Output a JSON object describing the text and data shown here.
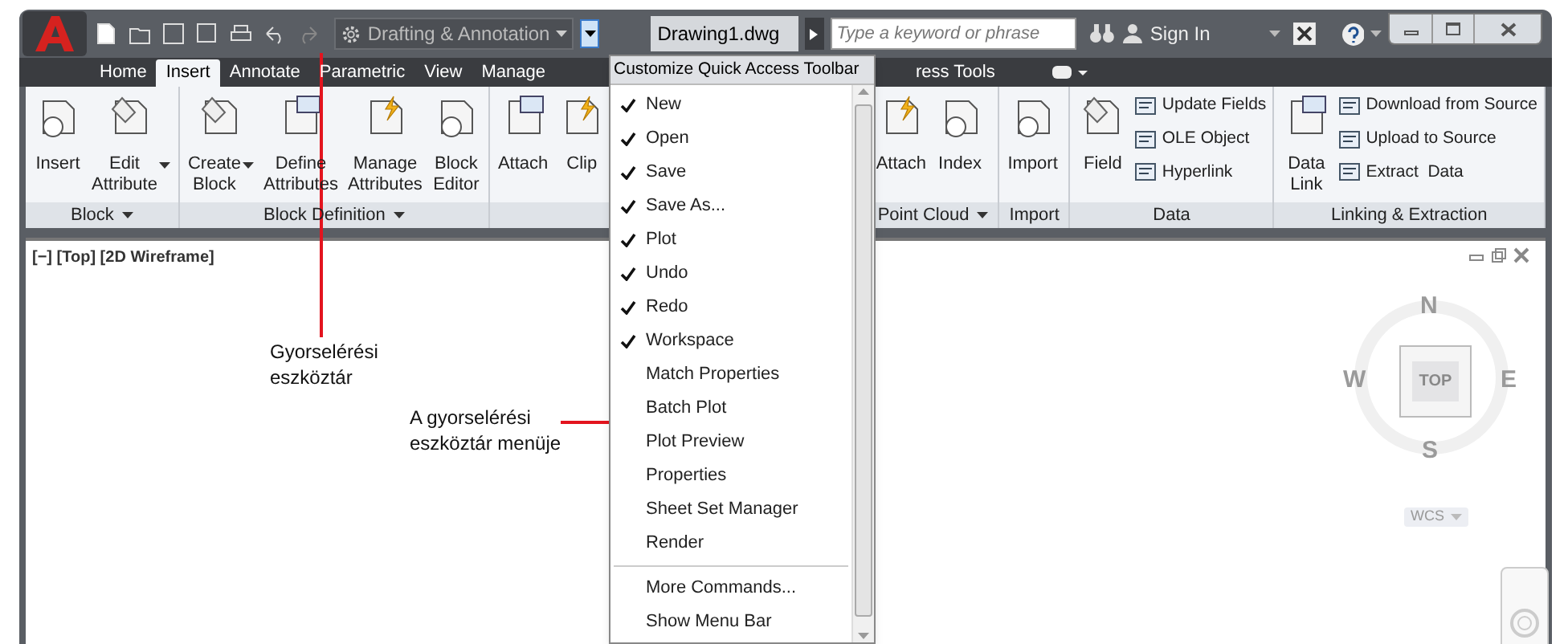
{
  "title_bar": {
    "workspace": "Drafting & Annotation",
    "document_title": "Drawing1.dwg",
    "search": {
      "placeholder": "Type a keyword or phrase"
    },
    "sign_in": "Sign In"
  },
  "tabs": [
    {
      "label": "Home",
      "selected": false,
      "kind": "full"
    },
    {
      "label": "Insert",
      "selected": true,
      "kind": "full"
    },
    {
      "label": "Annotate",
      "selected": false,
      "kind": "full"
    },
    {
      "label": "Parametric",
      "selected": false,
      "kind": "full"
    },
    {
      "label": "View",
      "selected": false,
      "kind": "full"
    },
    {
      "label": "Manage",
      "selected": false,
      "kind": "full"
    },
    {
      "label": "ress Tools",
      "selected": false,
      "kind": "cut"
    }
  ],
  "ribbon_panels": [
    {
      "title": "Block",
      "expandable": true,
      "tools": [
        {
          "kind": "large",
          "label": "Insert",
          "dropdown": false
        },
        {
          "kind": "large",
          "label": "Edit\nAttribute",
          "dropdown": true
        }
      ]
    },
    {
      "title": "Block Definition",
      "expandable": true,
      "tools": [
        {
          "kind": "large",
          "label": "Create\nBlock",
          "dropdown": true
        },
        {
          "kind": "large",
          "label": "Define\nAttributes",
          "dropdown": false
        },
        {
          "kind": "large",
          "label": "Manage\nAttributes",
          "dropdown": false
        },
        {
          "kind": "large",
          "label": "Block\nEditor",
          "dropdown": false
        }
      ]
    },
    {
      "tools": [
        {
          "kind": "large",
          "label": "Attach",
          "dropdown": false
        },
        {
          "kind": "large",
          "label": "Clip",
          "dropdown": false
        }
      ]
    },
    {
      "title": "Point Cloud",
      "expandable": true,
      "tools": [
        {
          "kind": "large",
          "label": "Attach",
          "dropdown": false
        },
        {
          "kind": "large",
          "label": "Index",
          "dropdown": false
        }
      ]
    },
    {
      "title": "Import",
      "expandable": false,
      "tools": [
        {
          "kind": "large",
          "label": "Import",
          "dropdown": false
        }
      ]
    },
    {
      "title": "Data",
      "expandable": false,
      "tools": [
        {
          "kind": "large",
          "label": "Field",
          "dropdown": false
        },
        {
          "kind": "small",
          "label": "Update Fields"
        },
        {
          "kind": "small",
          "label": "OLE Object"
        },
        {
          "kind": "small",
          "label": "Hyperlink"
        }
      ]
    },
    {
      "title": "Linking & Extraction",
      "expandable": false,
      "tools": [
        {
          "kind": "large",
          "label": "Data\nLink",
          "dropdown": false
        },
        {
          "kind": "small",
          "label": "Download from Source"
        },
        {
          "kind": "small",
          "label": "Upload to Source"
        },
        {
          "kind": "small",
          "label": "Extract  Data"
        }
      ]
    }
  ],
  "qat_menu": {
    "title": "Customize Quick Access Toolbar",
    "items": [
      {
        "label": "New",
        "checked": true
      },
      {
        "label": "Open",
        "checked": true
      },
      {
        "label": "Save",
        "checked": true
      },
      {
        "label": "Save As...",
        "checked": true
      },
      {
        "label": "Plot",
        "checked": true
      },
      {
        "label": "Undo",
        "checked": true
      },
      {
        "label": "Redo",
        "checked": true
      },
      {
        "label": "Workspace",
        "checked": true
      },
      {
        "label": "Match Properties",
        "checked": false
      },
      {
        "label": "Batch Plot",
        "checked": false
      },
      {
        "label": "Plot Preview",
        "checked": false
      },
      {
        "label": "Properties",
        "checked": false
      },
      {
        "label": "Sheet Set Manager",
        "checked": false
      },
      {
        "label": "Render",
        "checked": false
      }
    ],
    "commands": [
      "More Commands...",
      "Show Menu Bar"
    ]
  },
  "viewport": {
    "label": "[−] [Top] [2D Wireframe]",
    "viewcube": {
      "north": "N",
      "west": "W",
      "east": "E",
      "south": "S",
      "face": "TOP",
      "ucs": "WCS"
    }
  },
  "annotations": [
    {
      "kind": "vertical",
      "text": "Gyorselérési\neszköztár"
    },
    {
      "kind": "horizontal",
      "text": "A gyorselérési\neszköztár menüje"
    }
  ]
}
